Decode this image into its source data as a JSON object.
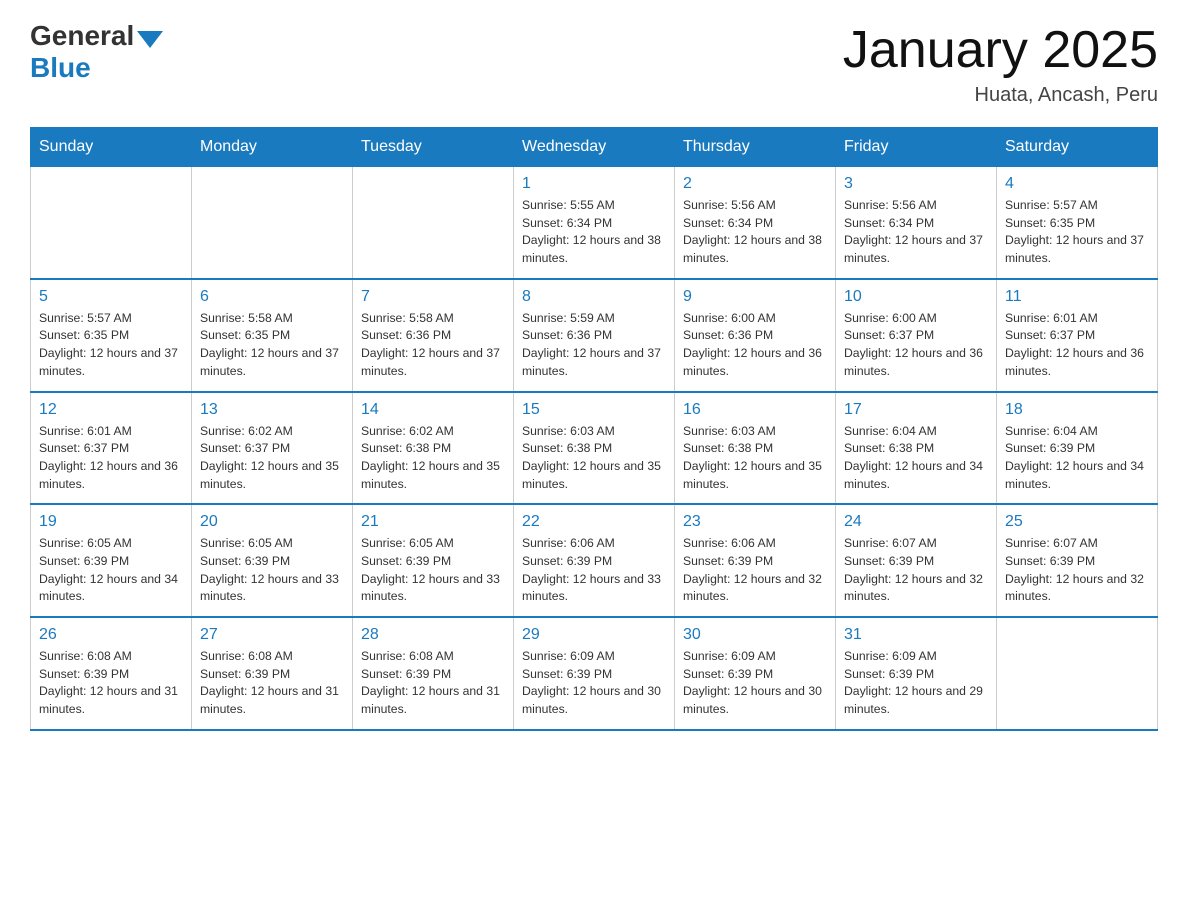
{
  "header": {
    "logo": {
      "general": "General",
      "blue": "Blue"
    },
    "title": "January 2025",
    "location": "Huata, Ancash, Peru"
  },
  "days_of_week": [
    "Sunday",
    "Monday",
    "Tuesday",
    "Wednesday",
    "Thursday",
    "Friday",
    "Saturday"
  ],
  "weeks": [
    [
      {
        "day": "",
        "info": ""
      },
      {
        "day": "",
        "info": ""
      },
      {
        "day": "",
        "info": ""
      },
      {
        "day": "1",
        "info": "Sunrise: 5:55 AM\nSunset: 6:34 PM\nDaylight: 12 hours and 38 minutes."
      },
      {
        "day": "2",
        "info": "Sunrise: 5:56 AM\nSunset: 6:34 PM\nDaylight: 12 hours and 38 minutes."
      },
      {
        "day": "3",
        "info": "Sunrise: 5:56 AM\nSunset: 6:34 PM\nDaylight: 12 hours and 37 minutes."
      },
      {
        "day": "4",
        "info": "Sunrise: 5:57 AM\nSunset: 6:35 PM\nDaylight: 12 hours and 37 minutes."
      }
    ],
    [
      {
        "day": "5",
        "info": "Sunrise: 5:57 AM\nSunset: 6:35 PM\nDaylight: 12 hours and 37 minutes."
      },
      {
        "day": "6",
        "info": "Sunrise: 5:58 AM\nSunset: 6:35 PM\nDaylight: 12 hours and 37 minutes."
      },
      {
        "day": "7",
        "info": "Sunrise: 5:58 AM\nSunset: 6:36 PM\nDaylight: 12 hours and 37 minutes."
      },
      {
        "day": "8",
        "info": "Sunrise: 5:59 AM\nSunset: 6:36 PM\nDaylight: 12 hours and 37 minutes."
      },
      {
        "day": "9",
        "info": "Sunrise: 6:00 AM\nSunset: 6:36 PM\nDaylight: 12 hours and 36 minutes."
      },
      {
        "day": "10",
        "info": "Sunrise: 6:00 AM\nSunset: 6:37 PM\nDaylight: 12 hours and 36 minutes."
      },
      {
        "day": "11",
        "info": "Sunrise: 6:01 AM\nSunset: 6:37 PM\nDaylight: 12 hours and 36 minutes."
      }
    ],
    [
      {
        "day": "12",
        "info": "Sunrise: 6:01 AM\nSunset: 6:37 PM\nDaylight: 12 hours and 36 minutes."
      },
      {
        "day": "13",
        "info": "Sunrise: 6:02 AM\nSunset: 6:37 PM\nDaylight: 12 hours and 35 minutes."
      },
      {
        "day": "14",
        "info": "Sunrise: 6:02 AM\nSunset: 6:38 PM\nDaylight: 12 hours and 35 minutes."
      },
      {
        "day": "15",
        "info": "Sunrise: 6:03 AM\nSunset: 6:38 PM\nDaylight: 12 hours and 35 minutes."
      },
      {
        "day": "16",
        "info": "Sunrise: 6:03 AM\nSunset: 6:38 PM\nDaylight: 12 hours and 35 minutes."
      },
      {
        "day": "17",
        "info": "Sunrise: 6:04 AM\nSunset: 6:38 PM\nDaylight: 12 hours and 34 minutes."
      },
      {
        "day": "18",
        "info": "Sunrise: 6:04 AM\nSunset: 6:39 PM\nDaylight: 12 hours and 34 minutes."
      }
    ],
    [
      {
        "day": "19",
        "info": "Sunrise: 6:05 AM\nSunset: 6:39 PM\nDaylight: 12 hours and 34 minutes."
      },
      {
        "day": "20",
        "info": "Sunrise: 6:05 AM\nSunset: 6:39 PM\nDaylight: 12 hours and 33 minutes."
      },
      {
        "day": "21",
        "info": "Sunrise: 6:05 AM\nSunset: 6:39 PM\nDaylight: 12 hours and 33 minutes."
      },
      {
        "day": "22",
        "info": "Sunrise: 6:06 AM\nSunset: 6:39 PM\nDaylight: 12 hours and 33 minutes."
      },
      {
        "day": "23",
        "info": "Sunrise: 6:06 AM\nSunset: 6:39 PM\nDaylight: 12 hours and 32 minutes."
      },
      {
        "day": "24",
        "info": "Sunrise: 6:07 AM\nSunset: 6:39 PM\nDaylight: 12 hours and 32 minutes."
      },
      {
        "day": "25",
        "info": "Sunrise: 6:07 AM\nSunset: 6:39 PM\nDaylight: 12 hours and 32 minutes."
      }
    ],
    [
      {
        "day": "26",
        "info": "Sunrise: 6:08 AM\nSunset: 6:39 PM\nDaylight: 12 hours and 31 minutes."
      },
      {
        "day": "27",
        "info": "Sunrise: 6:08 AM\nSunset: 6:39 PM\nDaylight: 12 hours and 31 minutes."
      },
      {
        "day": "28",
        "info": "Sunrise: 6:08 AM\nSunset: 6:39 PM\nDaylight: 12 hours and 31 minutes."
      },
      {
        "day": "29",
        "info": "Sunrise: 6:09 AM\nSunset: 6:39 PM\nDaylight: 12 hours and 30 minutes."
      },
      {
        "day": "30",
        "info": "Sunrise: 6:09 AM\nSunset: 6:39 PM\nDaylight: 12 hours and 30 minutes."
      },
      {
        "day": "31",
        "info": "Sunrise: 6:09 AM\nSunset: 6:39 PM\nDaylight: 12 hours and 29 minutes."
      },
      {
        "day": "",
        "info": ""
      }
    ]
  ]
}
